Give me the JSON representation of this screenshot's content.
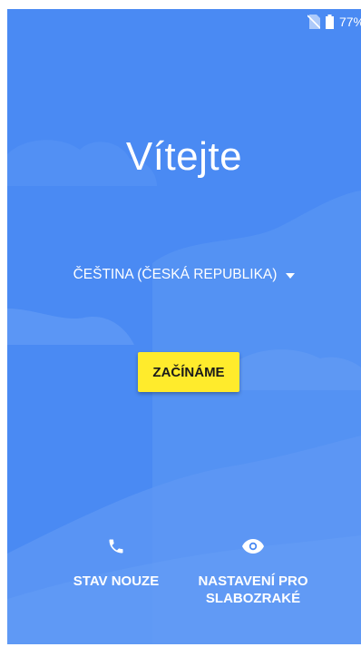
{
  "status_bar": {
    "sim_icon": "no-sim-icon",
    "battery_icon": "battery-icon",
    "battery_percent": "77%"
  },
  "welcome": {
    "title": "Vítejte"
  },
  "language": {
    "selected": "ČEŠTINA (ČESKÁ REPUBLIKA)",
    "icon": "dropdown-arrow-icon"
  },
  "start_button": {
    "label": "ZAČÍNÁME",
    "color": "#FFEB2C"
  },
  "bottom_actions": [
    {
      "icon": "phone-icon",
      "label": "STAV NOUZE"
    },
    {
      "icon": "eye-icon",
      "label_line1": "NASTAVENÍ PRO",
      "label_line2": "SLABOZRAKÉ"
    }
  ],
  "colors": {
    "background": "#4A8AF3",
    "text": "#ffffff"
  }
}
